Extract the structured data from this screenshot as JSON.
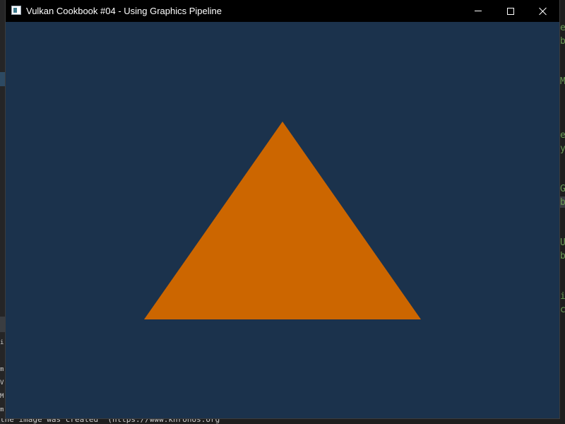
{
  "window": {
    "title": "Vulkan Cookbook #04 - Using Graphics Pipeline",
    "controls": {
      "minimize_icon": "minimize-icon",
      "maximize_icon": "maximize-icon",
      "close_icon": "close-icon"
    }
  },
  "viewport": {
    "clear_color": "#1b324c",
    "triangle_color": "#cc6600"
  },
  "background": {
    "right_edge_chars": "e\nb\n\n\nM\n\n\n\ne\ny\n\n\nG\nb\n\n\nU\nb\n\n\ni\nc",
    "left_edge_console": "i\n \nm\nV\nM\nm",
    "bottom_text": "the image was created` (https://www.khronos.org"
  },
  "colors": {
    "titlebar": "#000000",
    "title_text": "#ffffff",
    "editor_bg": "#1e1e1e"
  }
}
